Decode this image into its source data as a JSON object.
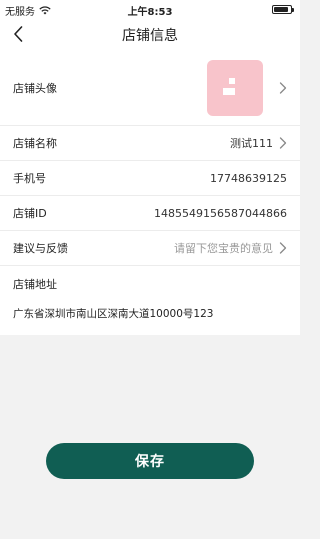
{
  "status_bar": {
    "carrier": "无服务",
    "time": "上午8:53",
    "battery_level": 0.9
  },
  "nav": {
    "title": "店铺信息",
    "back_icon": "chevron-left-icon"
  },
  "rows": {
    "avatar": {
      "label": "店铺头像"
    },
    "name": {
      "label": "店铺名称",
      "value": "测试111"
    },
    "phone": {
      "label": "手机号",
      "value": "17748639125"
    },
    "store_id": {
      "label": "店铺ID",
      "value": "1485549156587044866"
    },
    "feedback": {
      "label": "建议与反馈",
      "placeholder": "请留下您宝贵的意见"
    },
    "address": {
      "label": "店铺地址",
      "value": "广东省深圳市南山区深南大道10000号123"
    }
  },
  "save_button": {
    "label": "保存"
  },
  "colors": {
    "primary": "#105e53",
    "avatar_bg": "#f8c4cb",
    "page_bg": "#f2f2f2"
  }
}
